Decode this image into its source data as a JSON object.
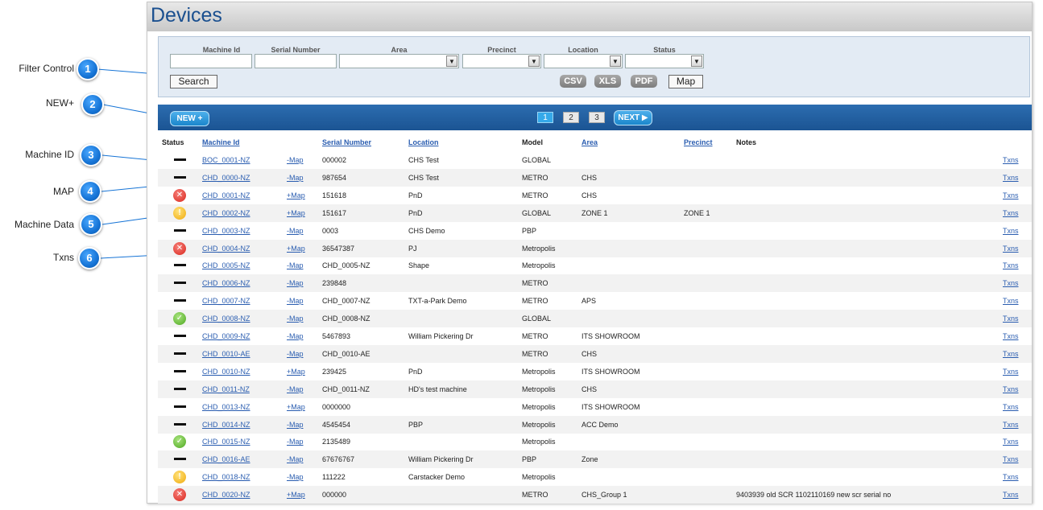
{
  "page": {
    "title": "Devices"
  },
  "callouts": [
    {
      "num": "1",
      "label": "Filter Control"
    },
    {
      "num": "2",
      "label": "NEW+"
    },
    {
      "num": "3",
      "label": "Machine ID"
    },
    {
      "num": "4",
      "label": "MAP"
    },
    {
      "num": "5",
      "label": "Machine Data"
    },
    {
      "num": "6",
      "label": "Txns"
    }
  ],
  "filter": {
    "labels": {
      "machine_id": "Machine Id",
      "serial_number": "Serial Number",
      "area": "Area",
      "precinct": "Precinct",
      "location": "Location",
      "status": "Status"
    },
    "search_label": "Search",
    "exports": {
      "csv": "CSV",
      "xls": "XLS",
      "pdf": "PDF"
    },
    "map_label": "Map"
  },
  "toolbar": {
    "new_label": "NEW +",
    "pages": [
      "1",
      "2",
      "3"
    ],
    "next_label": "NEXT ▶"
  },
  "table": {
    "headers": {
      "status": "Status",
      "machine_id": "Machine Id",
      "serial_number": "Serial Number",
      "location": "Location",
      "model": "Model",
      "area": "Area",
      "precinct": "Precinct",
      "notes": "Notes"
    },
    "rows": [
      {
        "status": "none",
        "machine_id": "BOC_0001-NZ",
        "map": "-Map",
        "serial": "000002",
        "location": "CHS Test",
        "model": "GLOBAL",
        "area": "",
        "precinct": "",
        "notes": "",
        "txns": "Txns"
      },
      {
        "status": "none",
        "machine_id": "CHD_0000-NZ",
        "map": "-Map",
        "serial": "987654",
        "location": "CHS Test",
        "model": "METRO",
        "area": "CHS",
        "precinct": "",
        "notes": "",
        "txns": "Txns"
      },
      {
        "status": "error",
        "machine_id": "CHD_0001-NZ",
        "map": "+Map",
        "serial": "151618",
        "location": "PnD",
        "model": "METRO",
        "area": "CHS",
        "precinct": "",
        "notes": "",
        "txns": "Txns"
      },
      {
        "status": "warn",
        "machine_id": "CHD_0002-NZ",
        "map": "+Map",
        "serial": "151617",
        "location": "PnD",
        "model": "GLOBAL",
        "area": "ZONE 1",
        "precinct": "ZONE 1",
        "notes": "",
        "txns": "Txns"
      },
      {
        "status": "none",
        "machine_id": "CHD_0003-NZ",
        "map": "-Map",
        "serial": "0003",
        "location": "CHS Demo",
        "model": "PBP",
        "area": "",
        "precinct": "",
        "notes": "",
        "txns": "Txns"
      },
      {
        "status": "error",
        "machine_id": "CHD_0004-NZ",
        "map": "+Map",
        "serial": "36547387",
        "location": "PJ",
        "model": "Metropolis",
        "area": "",
        "precinct": "",
        "notes": "",
        "txns": "Txns"
      },
      {
        "status": "none",
        "machine_id": "CHD_0005-NZ",
        "map": "-Map",
        "serial": "CHD_0005-NZ",
        "location": "Shape",
        "model": "Metropolis",
        "area": "",
        "precinct": "",
        "notes": "",
        "txns": "Txns"
      },
      {
        "status": "none",
        "machine_id": "CHD_0006-NZ",
        "map": "-Map",
        "serial": "239848",
        "location": "",
        "model": "METRO",
        "area": "",
        "precinct": "",
        "notes": "",
        "txns": "Txns"
      },
      {
        "status": "none",
        "machine_id": "CHD_0007-NZ",
        "map": "-Map",
        "serial": "CHD_0007-NZ",
        "location": "TXT-a-Park Demo",
        "model": "METRO",
        "area": "APS",
        "precinct": "",
        "notes": "",
        "txns": "Txns"
      },
      {
        "status": "ok",
        "machine_id": "CHD_0008-NZ",
        "map": "-Map",
        "serial": "CHD_0008-NZ",
        "location": "",
        "model": "GLOBAL",
        "area": "",
        "precinct": "",
        "notes": "",
        "txns": "Txns"
      },
      {
        "status": "none",
        "machine_id": "CHD_0009-NZ",
        "map": "-Map",
        "serial": "5467893",
        "location": "William Pickering Dr",
        "model": "METRO",
        "area": "ITS SHOWROOM",
        "precinct": "",
        "notes": "",
        "txns": "Txns"
      },
      {
        "status": "none",
        "machine_id": "CHD_0010-AE",
        "map": "-Map",
        "serial": "CHD_0010-AE",
        "location": "",
        "model": "METRO",
        "area": "CHS",
        "precinct": "",
        "notes": "",
        "txns": "Txns"
      },
      {
        "status": "none",
        "machine_id": "CHD_0010-NZ",
        "map": "+Map",
        "serial": "239425",
        "location": "PnD",
        "model": "Metropolis",
        "area": "ITS SHOWROOM",
        "precinct": "",
        "notes": "",
        "txns": "Txns"
      },
      {
        "status": "none",
        "machine_id": "CHD_0011-NZ",
        "map": "-Map",
        "serial": "CHD_0011-NZ",
        "location": "HD's test machine",
        "model": "Metropolis",
        "area": "CHS",
        "precinct": "",
        "notes": "",
        "txns": "Txns"
      },
      {
        "status": "none",
        "machine_id": "CHD_0013-NZ",
        "map": "+Map",
        "serial": "0000000",
        "location": "",
        "model": "Metropolis",
        "area": "ITS SHOWROOM",
        "precinct": "",
        "notes": "",
        "txns": "Txns"
      },
      {
        "status": "none",
        "machine_id": "CHD_0014-NZ",
        "map": "-Map",
        "serial": "4545454",
        "location": "PBP",
        "model": "Metropolis",
        "area": "ACC Demo",
        "precinct": "",
        "notes": "",
        "txns": "Txns"
      },
      {
        "status": "ok",
        "machine_id": "CHD_0015-NZ",
        "map": "-Map",
        "serial": "2135489",
        "location": "",
        "model": "Metropolis",
        "area": "",
        "precinct": "",
        "notes": "",
        "txns": "Txns"
      },
      {
        "status": "none",
        "machine_id": "CHD_0016-AE",
        "map": "-Map",
        "serial": "67676767",
        "location": "William Pickering Dr",
        "model": "PBP",
        "area": "Zone",
        "precinct": "",
        "notes": "",
        "txns": "Txns"
      },
      {
        "status": "warn",
        "machine_id": "CHD_0018-NZ",
        "map": "-Map",
        "serial": "111222",
        "location": "Carstacker Demo",
        "model": "Metropolis",
        "area": "",
        "precinct": "",
        "notes": "",
        "txns": "Txns"
      },
      {
        "status": "error",
        "machine_id": "CHD_0020-NZ",
        "map": "+Map",
        "serial": "000000",
        "location": "",
        "model": "METRO",
        "area": "CHS_Group 1",
        "precinct": "",
        "notes": "9403939 old SCR 1102110169 new scr serial no",
        "txns": "Txns"
      }
    ]
  },
  "icons": {
    "error": "x-circle-icon",
    "ok": "check-circle-icon",
    "warn": "exclamation-circle-icon",
    "none": "dash-icon"
  },
  "colors": {
    "accent": "#1b5493",
    "link": "#2a5db0",
    "callout": "#1674d6"
  }
}
